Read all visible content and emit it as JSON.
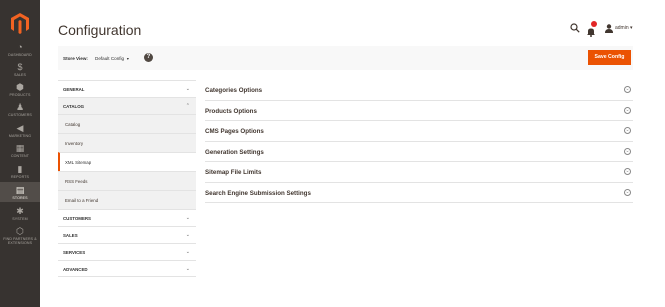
{
  "nav": {
    "items": [
      {
        "icon": "dashboard-icon",
        "label": "Dashboard",
        "glyph": "◔"
      },
      {
        "icon": "dollar-icon",
        "label": "Sales",
        "glyph": "$"
      },
      {
        "icon": "box-icon",
        "label": "Products",
        "glyph": "⬢"
      },
      {
        "icon": "person-icon",
        "label": "Customers",
        "glyph": "♟"
      },
      {
        "icon": "megaphone-icon",
        "label": "Marketing",
        "glyph": "◀"
      },
      {
        "icon": "content-icon",
        "label": "Content",
        "glyph": "▦"
      },
      {
        "icon": "bar-chart-icon",
        "label": "Reports",
        "glyph": "▮"
      },
      {
        "icon": "store-icon",
        "label": "Stores",
        "glyph": "▤"
      },
      {
        "icon": "gear-icon",
        "label": "System",
        "glyph": "✱"
      },
      {
        "icon": "extensions-icon",
        "label": "Find Partners & Extensions",
        "glyph": "⬡"
      }
    ]
  },
  "header": {
    "title": "Configuration",
    "username": "admin ▾"
  },
  "store_bar": {
    "label": "Store View:",
    "selected": "Default Config",
    "caret": "▼",
    "help": "?"
  },
  "actions": {
    "save_label": "Save Config"
  },
  "tabs": {
    "general": "GENERAL",
    "catalog": "CATALOG",
    "catalog_items": [
      "Catalog",
      "Inventory",
      "XML Sitemap",
      "RSS Feeds",
      "Email to a Friend"
    ],
    "customers": "CUSTOMERS",
    "sales": "SALES",
    "services": "SERVICES",
    "advanced": "ADVANCED",
    "chev_down": "⌄",
    "chev_up": "⌃"
  },
  "sections": [
    "Categories Options",
    "Products Options",
    "CMS Pages Options",
    "Generation Settings",
    "Sitemap File Limits",
    "Search Engine Submission Settings"
  ],
  "colors": {
    "nav_bg": "#373330",
    "accent": "#eb5202",
    "badge": "#e22626"
  }
}
